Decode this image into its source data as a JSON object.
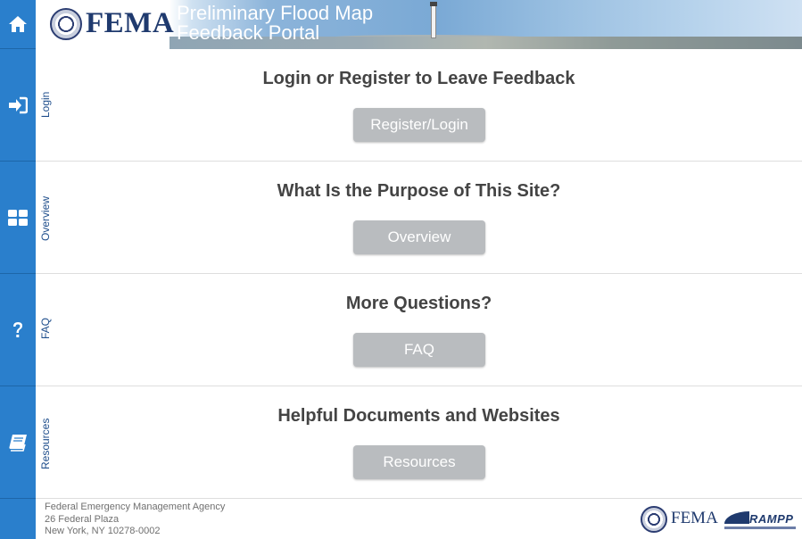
{
  "header": {
    "logo_text": "FEMA",
    "portal_title_line1": "Preliminary Flood Map",
    "portal_title_line2": "Feedback Portal"
  },
  "rail": {
    "home_icon": "home-icon",
    "login_icon": "sign-in-icon",
    "overview_icon": "grid-icon",
    "faq_icon": "question-icon",
    "resources_icon": "book-icon",
    "color": "#2a7fcc"
  },
  "sections": [
    {
      "tab": "Login",
      "heading": "Login or Register to Leave Feedback",
      "button": "Register/Login"
    },
    {
      "tab": "Overview",
      "heading": "What Is the Purpose of This Site?",
      "button": "Overview"
    },
    {
      "tab": "FAQ",
      "heading": "More Questions?",
      "button": "FAQ"
    },
    {
      "tab": "Resources",
      "heading": "Helpful Documents and Websites",
      "button": "Resources"
    }
  ],
  "footer": {
    "address_line1": "Federal Emergency Management Agency",
    "address_line2": "26 Federal Plaza",
    "address_line3": "New York, NY 10278-0002",
    "fema_logo_text": "FEMA",
    "rampp_logo_text": "RAMPP"
  }
}
